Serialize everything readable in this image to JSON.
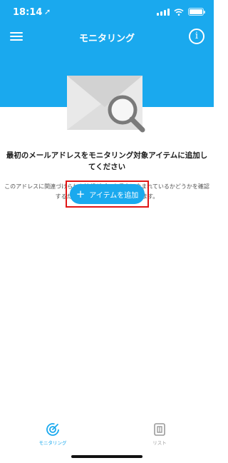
{
  "status_bar": {
    "time": "18:14",
    "battery_level": 1.0
  },
  "header": {
    "title": "モニタリング",
    "menu_icon": "hamburger-menu-icon",
    "info_icon": "info-icon"
  },
  "empty_state": {
    "illustration": "envelope-magnifier-illustration",
    "heading": "最初のメールアドレスをモニタリング対象アイテムに追加してください",
    "description": "このアドレスに関連づけられた情報がデータ侵害に含まれているかどうかを確認するためにWebをモニタリングします。",
    "add_button_label": "アイテムを追加",
    "add_button_icon": "plus-icon"
  },
  "tab_bar": {
    "tabs": [
      {
        "label": "モニタリング",
        "icon": "monitoring-icon",
        "active": true
      },
      {
        "label": "リスト",
        "icon": "list-icon",
        "active": false
      }
    ]
  },
  "colors": {
    "accent": "#1aa9ee",
    "highlight": "#e01515",
    "background": "#ffffff"
  }
}
